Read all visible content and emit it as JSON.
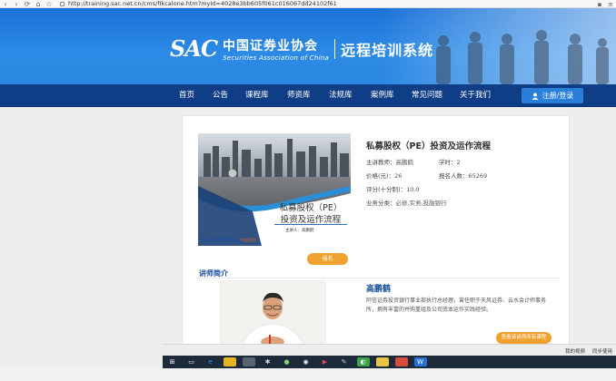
{
  "browser": {
    "url": "http://training.sac.net.cn/cms/fIkcalone.htm?myId=4028e3bb605f061c016067dd24102f61"
  },
  "banner": {
    "logo_text": "SAC",
    "org_name_cn": "中国证券业协会",
    "org_name_en": "Securities Association of China",
    "system_title": "远程培训系统"
  },
  "nav": {
    "items": [
      "首页",
      "公告",
      "课程库",
      "师资库",
      "法规库",
      "案例库",
      "常见问题",
      "关于我们"
    ],
    "login_label": "注册/登录"
  },
  "course": {
    "cover_title_line1": "私募股权（PE）",
    "cover_title_line2": "投资及运作流程",
    "cover_speaker": "主讲人：高鹏鹤",
    "cover_logo": "SAC中国证券业协会",
    "cover_logo2": "中国证券",
    "title": "私募股权（PE）投资及运作流程",
    "teacher_label": "主讲教师：",
    "teacher_value": "高鹏鹤",
    "credits_label": "学时：",
    "credits_value": "2",
    "price_label": "价格(元)：",
    "price_value": "26",
    "enrolled_label": "报名人数：",
    "enrolled_value": "65269",
    "score_label": "评分(十分制)：",
    "score_value": "10.0",
    "category_label": "业务分类：",
    "category_value": "必修,实务,投融银行",
    "signup_label": "报名"
  },
  "teacher": {
    "section_heading": "讲师简介",
    "name": "高鹏鹤",
    "bio": "阿信证券投资银行事业部执行总经理，曾任职于天风证券、云水会计师事务所，拥有丰富的并购重组及公司资本运作实践经验。",
    "view_all_label": "查看该讲师所有课程"
  },
  "taskbar": {
    "right_items": [
      "我的视频",
      "同步使用"
    ]
  },
  "colors": {
    "nav_bg": "#0f3e86",
    "banner_blue": "#2c8ae6",
    "accent_orange": "#f0a231",
    "link_blue": "#1b4f9a"
  }
}
